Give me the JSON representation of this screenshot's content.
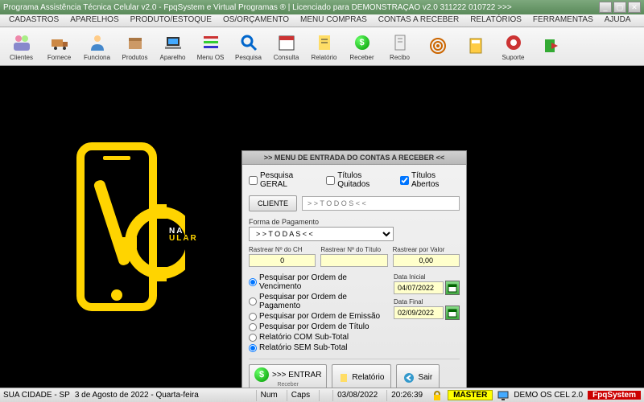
{
  "window": {
    "title": "Programa Assistência Técnica Celular v2.0 - FpqSystem e Virtual Programas ® | Licenciado para  DEMONSTRAÇÃO v2.0 311222 010722 >>>"
  },
  "menu": [
    "CADASTROS",
    "APARELHOS",
    "PRODUTO/ESTOQUE",
    "OS/ORÇAMENTO",
    "MENU COMPRAS",
    "CONTAS A RECEBER",
    "RELATÓRIOS",
    "FERRAMENTAS",
    "AJUDA"
  ],
  "toolbar": [
    {
      "label": "Clientes",
      "icon": "users"
    },
    {
      "label": "Fornece",
      "icon": "truck"
    },
    {
      "label": "Funciona",
      "icon": "people"
    },
    {
      "label": "Produtos",
      "icon": "box"
    },
    {
      "label": "Aparelho",
      "icon": "laptop"
    },
    {
      "label": "Menu OS",
      "icon": "menu"
    },
    {
      "label": "Pesquisa",
      "icon": "search"
    },
    {
      "label": "Consulta",
      "icon": "calendar"
    },
    {
      "label": "Relatório",
      "icon": "report"
    },
    {
      "label": "Receber",
      "icon": "money"
    },
    {
      "label": "Recibo",
      "icon": "receipt"
    },
    {
      "label": "",
      "icon": "target"
    },
    {
      "label": "",
      "icon": "calc"
    },
    {
      "label": "Suporte",
      "icon": "support"
    },
    {
      "label": "",
      "icon": "exit"
    }
  ],
  "dialog": {
    "title": ">>  MENU DE ENTRADA DO CONTAS A RECEBER  <<",
    "chk_geral": "Pesquisa GERAL",
    "chk_quitados": "Títulos Quitados",
    "chk_abertos": "Títulos Abertos",
    "btn_cliente": "CLIENTE",
    "todos": "> > T O D O S < <",
    "forma_label": "Forma de Pagamento",
    "forma_value": "> > T O D A S < <",
    "rastrear_ch": "Rastrear Nº do CH",
    "rastrear_titulo": "Rastrear Nº do Título",
    "rastrear_valor": "Rastrear por Valor",
    "val_ch": "0",
    "val_titulo": "",
    "val_valor": "0,00",
    "radios": [
      "Pesquisar por Ordem de Vencimento",
      "Pesquisar por Ordem de Pagamento",
      "Pesquisar por Ordem de Emissão",
      "Pesquisar por Ordem de Título",
      "Relatório COM Sub-Total",
      "Relatório SEM Sub-Total"
    ],
    "data_inicial_label": "Data Inicial",
    "data_inicial": "04/07/2022",
    "data_final_label": "Data Final",
    "data_final": "02/09/2022",
    "btn_entrar": ">>> ENTRAR",
    "btn_entrar_sub": "Receber",
    "btn_relatorio": "Relatório",
    "btn_sair": "Sair"
  },
  "brand": {
    "line1": "NA",
    "line2": "ULAR"
  },
  "status": {
    "city": "SUA CIDADE - SP",
    "date_long": "3 de Agosto de 2022 - Quarta-feira",
    "num": "Num",
    "caps": "Caps",
    "date": "03/08/2022",
    "time": "20:26:39",
    "master": "MASTER",
    "demo": "DEMO OS CEL 2.0",
    "brand": "FpqSystem"
  }
}
